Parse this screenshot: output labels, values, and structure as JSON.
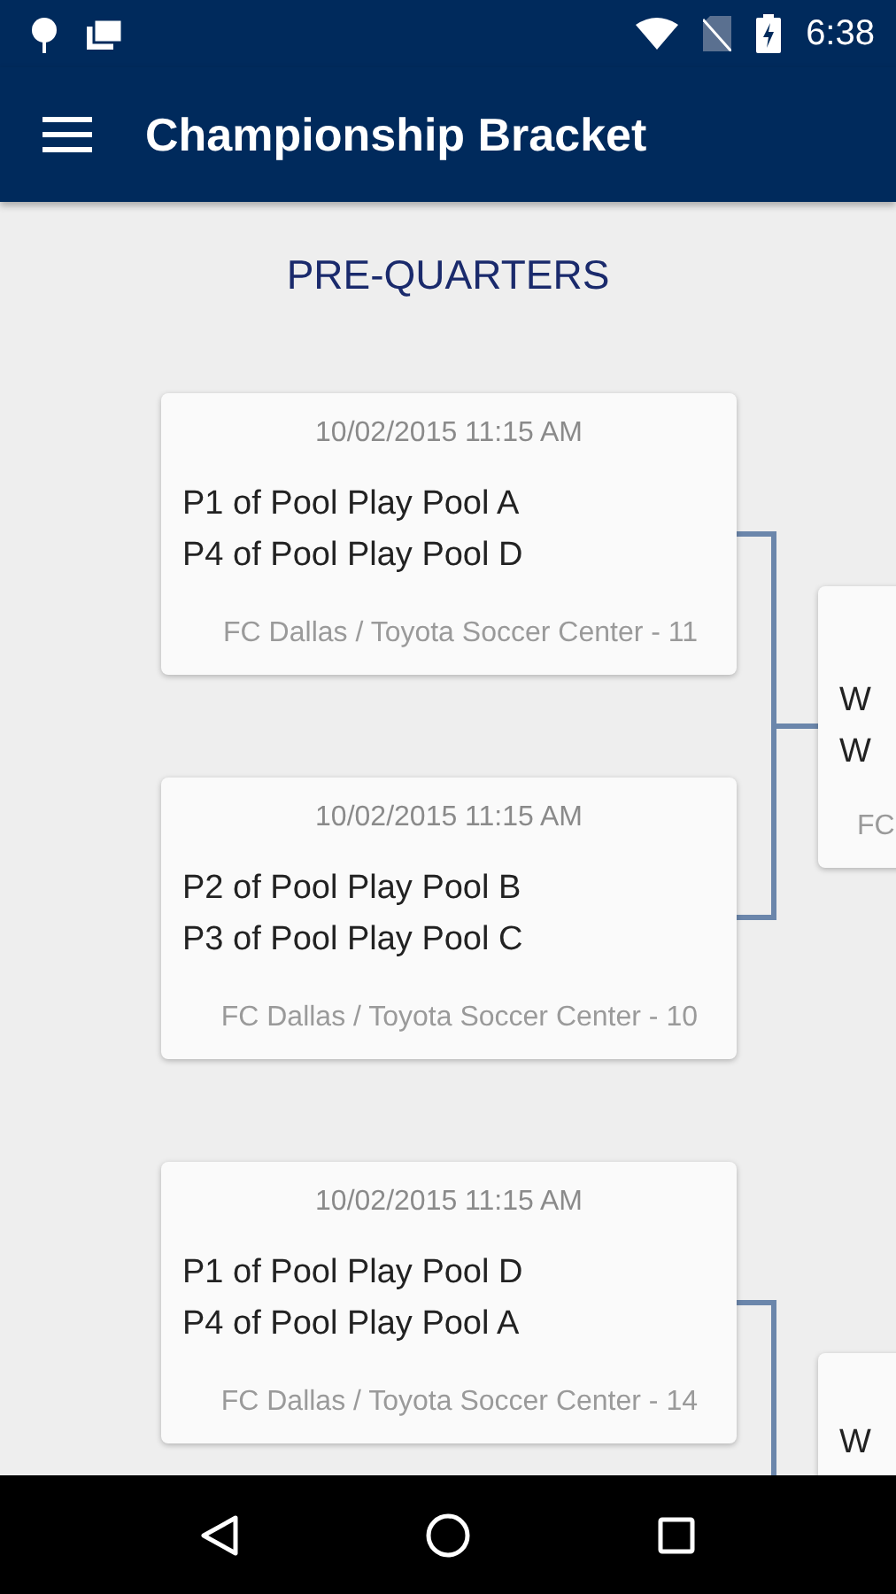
{
  "status_bar": {
    "time": "6:38"
  },
  "app_bar": {
    "title": "Championship Bracket"
  },
  "round": {
    "title": "PRE-QUARTERS"
  },
  "matches": [
    {
      "date": "10/02/2015 11:15 AM",
      "team1": "P1 of Pool Play Pool A",
      "team2": "P4 of Pool Play Pool D",
      "venue": "FC Dallas / Toyota Soccer Center - 11"
    },
    {
      "date": "10/02/2015 11:15 AM",
      "team1": "P2 of Pool Play Pool B",
      "team2": "P3 of Pool Play Pool C",
      "venue": "FC Dallas / Toyota Soccer Center - 10"
    },
    {
      "date": "10/02/2015 11:15 AM",
      "team1": "P1 of Pool Play Pool D",
      "team2": "P4 of Pool Play Pool A",
      "venue": "FC Dallas / Toyota Soccer Center - 14"
    }
  ],
  "next_round": [
    {
      "team1": "W",
      "team2": "W",
      "venue": "FC"
    },
    {
      "team1": "W"
    }
  ]
}
